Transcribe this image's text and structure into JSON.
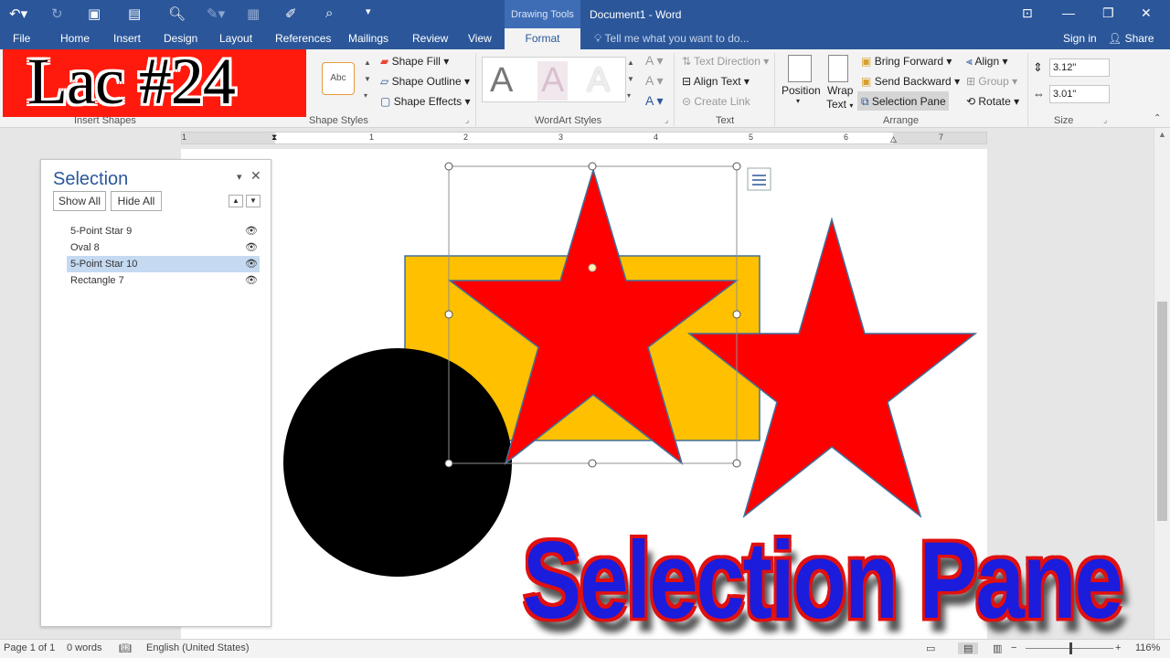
{
  "qat": {
    "undo_icon": "undo-icon",
    "redo_icon": "redo-icon"
  },
  "context_tab_group": "Drawing Tools",
  "window_title": "Document1 - Word",
  "tabs": [
    "File",
    "Home",
    "Insert",
    "Design",
    "Layout",
    "References",
    "Mailings",
    "Review",
    "View",
    "Format"
  ],
  "tell_me": "Tell me what you want to do...",
  "account": {
    "sign_in": "Sign in",
    "share": "Share"
  },
  "banner": {
    "text": "Lac #24"
  },
  "ribbon": {
    "insert_shapes_label": "Insert Shapes",
    "shape_styles": {
      "label": "Shape Styles",
      "preview": "Abc",
      "fill": "Shape Fill",
      "outline": "Shape Outline",
      "effects": "Shape Effects"
    },
    "wordart_styles": {
      "label": "WordArt Styles",
      "preview": "A"
    },
    "text": {
      "label": "Text",
      "direction": "Text Direction",
      "align": "Align Text",
      "link": "Create Link"
    },
    "arrange": {
      "label": "Arrange",
      "position": "Position",
      "wrap": "Wrap",
      "wrap2": "Text",
      "bring_forward": "Bring Forward",
      "send_backward": "Send Backward",
      "selection_pane": "Selection Pane",
      "align": "Align",
      "group": "Group",
      "rotate": "Rotate"
    },
    "size": {
      "label": "Size",
      "height": "3.12\"",
      "width": "3.01\""
    }
  },
  "ruler": {
    "numbers": [
      "1",
      "1",
      "2",
      "3",
      "4",
      "5",
      "6",
      "7"
    ]
  },
  "selection_pane": {
    "title": "Selection",
    "show_all": "Show All",
    "hide_all": "Hide All",
    "items": [
      {
        "label": "5-Point Star 9",
        "active": false
      },
      {
        "label": "Oval 8",
        "active": false
      },
      {
        "label": "5-Point Star 10",
        "active": true
      },
      {
        "label": "Rectangle 7",
        "active": false
      }
    ]
  },
  "overlay_text": "Selection Pane",
  "status": {
    "page": "Page 1 of 1",
    "words": "0 words",
    "language": "English (United States)",
    "zoom": "116%"
  },
  "colors": {
    "accent": "#2b579a",
    "rectangle": "#ffc000",
    "star": "#ff0000",
    "oval": "#000000"
  }
}
